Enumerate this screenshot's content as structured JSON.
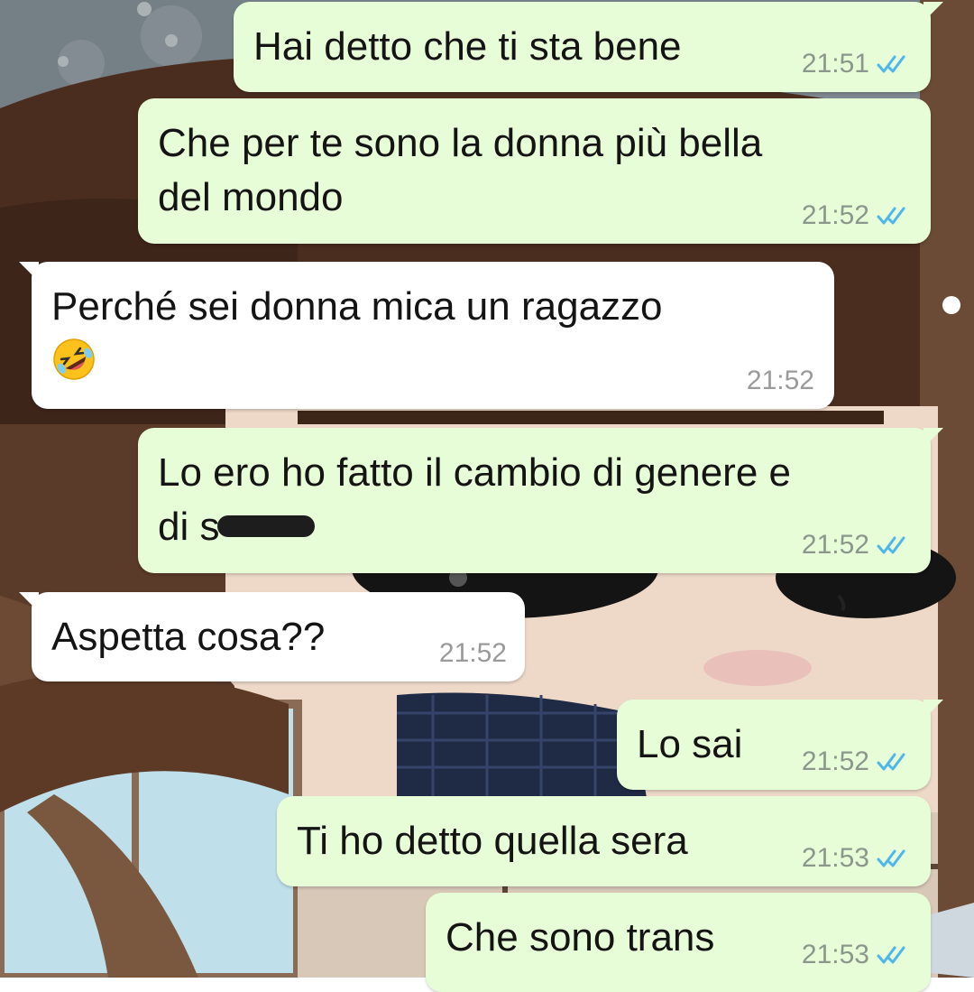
{
  "chat": {
    "messages": [
      {
        "direction": "outgoing",
        "lines": [
          "Hai detto che ti sta bene"
        ],
        "time": "21:51",
        "status": "read"
      },
      {
        "direction": "outgoing",
        "lines": [
          "Che per te sono la donna più bella",
          "del mondo"
        ],
        "time": "21:52",
        "status": "read"
      },
      {
        "direction": "incoming",
        "lines": [
          "Perché sei donna mica un ragazzo"
        ],
        "emoji": "rolling-on-the-floor-laughing",
        "time": "21:52"
      },
      {
        "direction": "outgoing",
        "lines": [
          "Lo ero ho fatto il cambio di genere e",
          "di s"
        ],
        "redacted": true,
        "time": "21:52",
        "status": "read"
      },
      {
        "direction": "incoming",
        "lines": [
          "Aspetta cosa??"
        ],
        "time": "21:52"
      },
      {
        "direction": "outgoing",
        "lines": [
          "Lo sai"
        ],
        "time": "21:52",
        "status": "read"
      },
      {
        "direction": "outgoing",
        "lines": [
          "Ti ho detto quella sera"
        ],
        "time": "21:53",
        "status": "read"
      },
      {
        "direction": "outgoing",
        "lines": [
          "Che sono trans"
        ],
        "time": "21:53",
        "status": "read"
      }
    ]
  },
  "colors": {
    "outgoing_bubble": "#e7fdd7",
    "incoming_bubble": "#ffffff",
    "read_ticks": "#4fb6ec",
    "timestamp": "#8a978a"
  },
  "icons": {
    "read_receipt": "double-check-icon",
    "emoji": "rofl-emoji-icon"
  }
}
